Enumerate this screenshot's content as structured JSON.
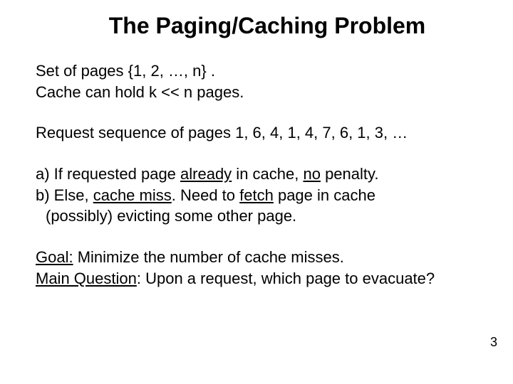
{
  "title": "The Paging/Caching Problem",
  "p1": {
    "l1a": "Set of pages {1, 2, …, n} .",
    "l2a": "Cache can hold k << n pages."
  },
  "p2": "Request sequence of pages 1, 6, 4, 1, 4, 7, 6, 1, 3, …",
  "p3": {
    "a_pre": "a) If requested page ",
    "a_u1": "already",
    "a_mid": " in cache, ",
    "a_u2": "no",
    "a_post": " penalty.",
    "b_pre": "b) Else, ",
    "b_u1": "cache miss",
    "b_mid": ". Need to ",
    "b_u2": "fetch",
    "b_post": " page in cache",
    "b_line2": "(possibly) evicting some other page."
  },
  "p4": {
    "goal_u": "Goal:",
    "goal_rest": "  Minimize the number of cache misses.",
    "mq_u": "Main Question",
    "mq_rest": ": Upon a request, which page to evacuate?"
  },
  "page_number": "3"
}
